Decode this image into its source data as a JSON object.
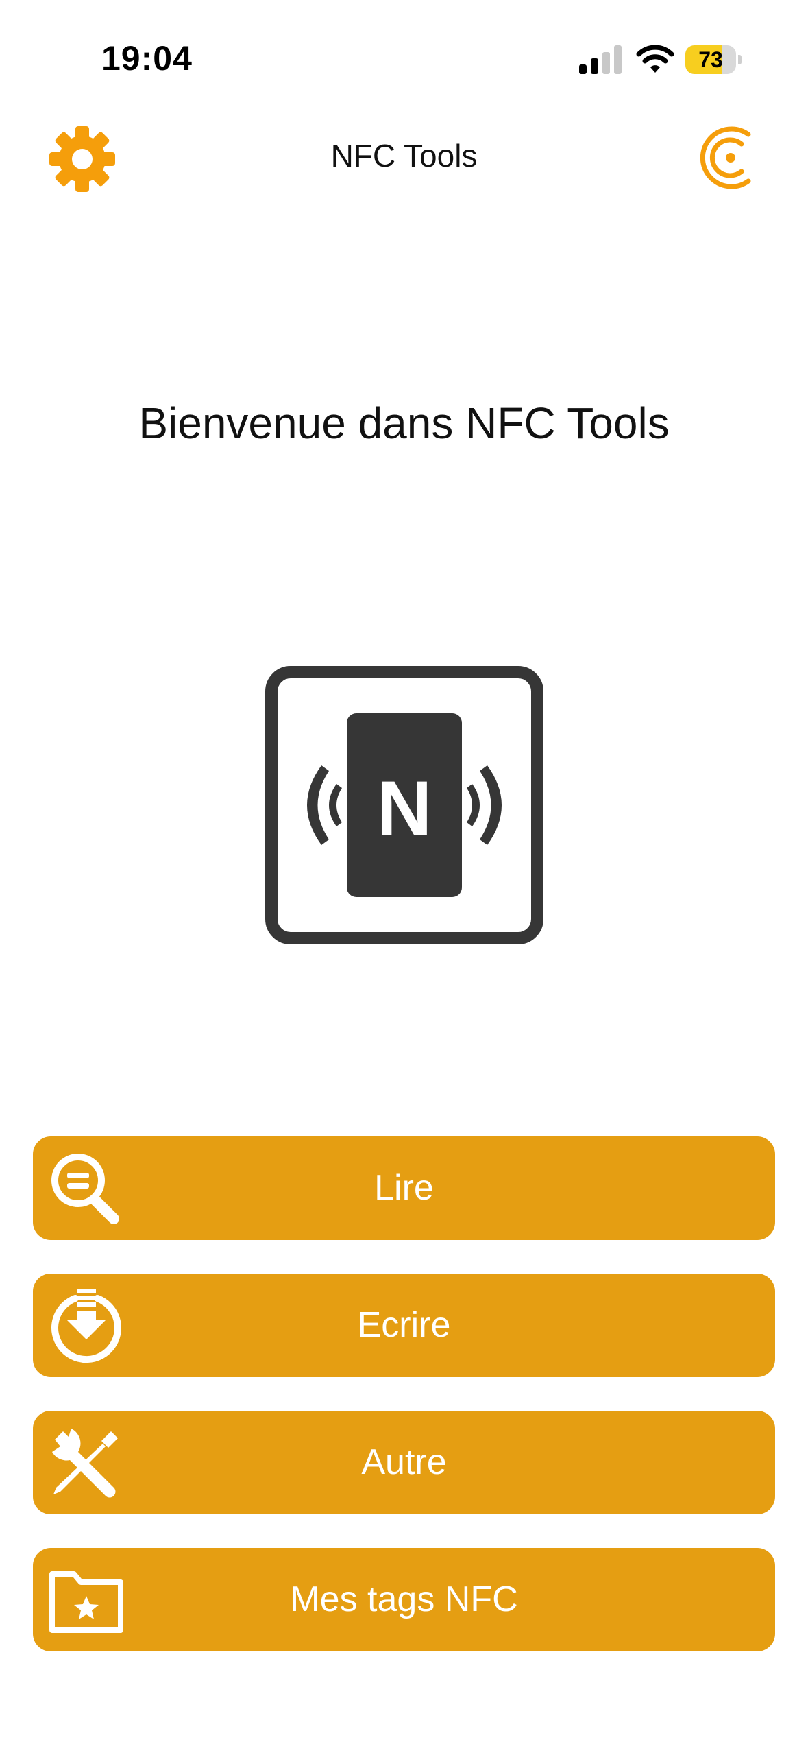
{
  "status_bar": {
    "time": "19:04",
    "battery_level": "73",
    "battery_percent": 73,
    "signal_bars_filled": 2,
    "signal_bars_total": 4,
    "icons": [
      "cellular-signal-icon",
      "wifi-icon",
      "battery-icon"
    ]
  },
  "nav": {
    "title": "NFC Tools",
    "left_icon": "gear-icon",
    "right_icon": "app-logo-icon"
  },
  "main": {
    "welcome": "Bienvenue dans NFC Tools",
    "illustration_letter": "N",
    "illustration_icon": "nfc-phone-icon"
  },
  "menu": [
    {
      "label": "Lire",
      "icon": "read-magnifier-icon"
    },
    {
      "label": "Ecrire",
      "icon": "write-download-icon"
    },
    {
      "label": "Autre",
      "icon": "tools-icon"
    },
    {
      "label": "Mes tags NFC",
      "icon": "starred-folder-icon"
    }
  ],
  "colors": {
    "accent": "#E59E12",
    "gear": "#F59E0B",
    "battery": "#F7CE1F",
    "icon_dark": "#363636",
    "button_text": "#FFFFFF"
  }
}
